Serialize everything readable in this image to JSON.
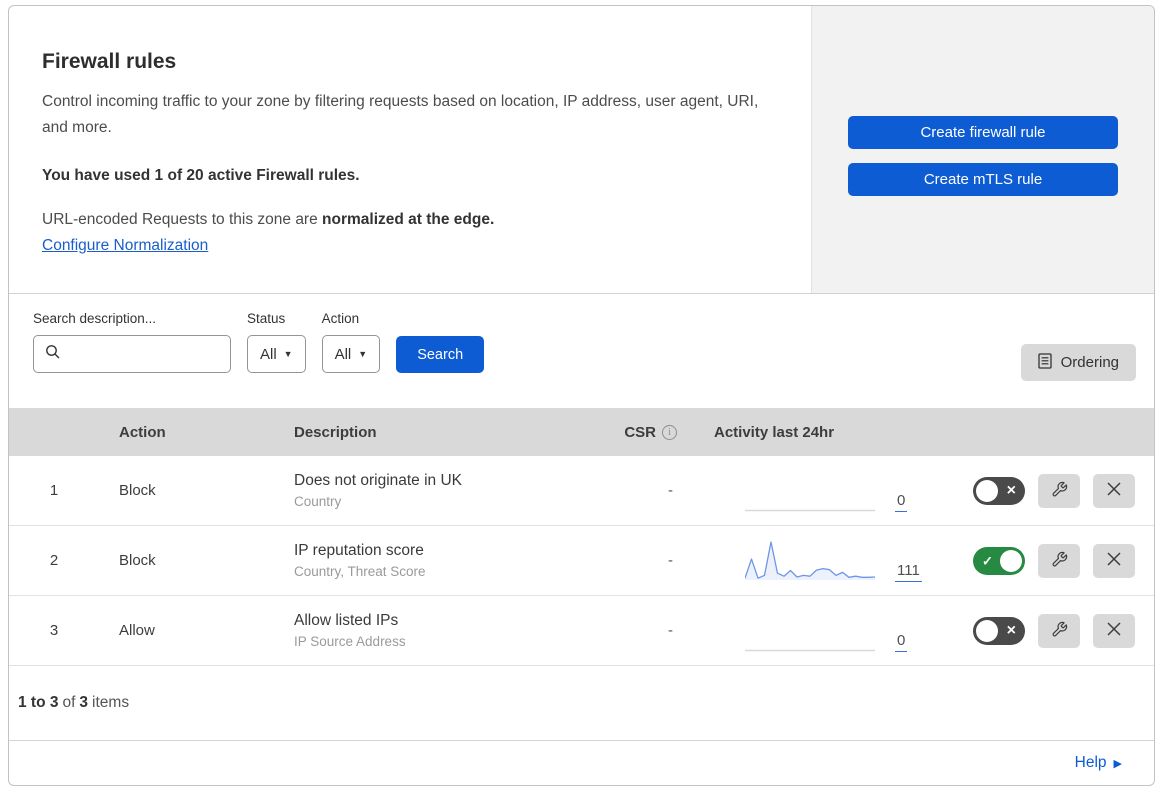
{
  "header": {
    "title": "Firewall rules",
    "description": "Control incoming traffic to your zone by filtering requests based on location, IP address, user agent, URI, and more.",
    "usage": "You have used 1 of 20 active Firewall rules.",
    "normalization_prefix": "URL-encoded Requests to this zone are ",
    "normalization_bold": "normalized at the edge.",
    "normalization_link": "Configure Normalization",
    "create_firewall_button": "Create firewall rule",
    "create_mtls_button": "Create mTLS rule"
  },
  "filters": {
    "search_label": "Search description...",
    "status_label": "Status",
    "status_value": "All",
    "action_label": "Action",
    "action_value": "All",
    "search_button": "Search",
    "ordering_button": "Ordering"
  },
  "table": {
    "columns": {
      "action": "Action",
      "description": "Description",
      "csr": "CSR",
      "activity": "Activity last 24hr"
    },
    "rows": [
      {
        "index": "1",
        "action": "Block",
        "description": "Does not originate in UK",
        "criteria": "Country",
        "csr": "-",
        "activity_count": "0",
        "enabled": false,
        "sparkline": []
      },
      {
        "index": "2",
        "action": "Block",
        "description": "IP reputation score",
        "criteria": "Country, Threat Score",
        "csr": "-",
        "activity_count": "111",
        "enabled": true,
        "sparkline": [
          5,
          55,
          5,
          12,
          100,
          18,
          10,
          25,
          8,
          12,
          10,
          26,
          30,
          27,
          12,
          20,
          7,
          10,
          7,
          7,
          8
        ]
      },
      {
        "index": "3",
        "action": "Allow",
        "description": "Allow listed IPs",
        "criteria": "IP Source Address",
        "csr": "-",
        "activity_count": "0",
        "enabled": false,
        "sparkline": []
      }
    ],
    "summary": {
      "range": "1 to 3",
      "of": "of",
      "total": "3",
      "items": "items"
    }
  },
  "footer": {
    "help_label": "Help"
  },
  "colors": {
    "accent_blue": "#0d5cd4",
    "toggle_on_green": "#278a43",
    "toggle_off_gray": "#4a4a4a",
    "sparkline_blue": "#6e96e6",
    "panel_gray": "#f2f2f2",
    "header_gray": "#d9d9d9"
  }
}
